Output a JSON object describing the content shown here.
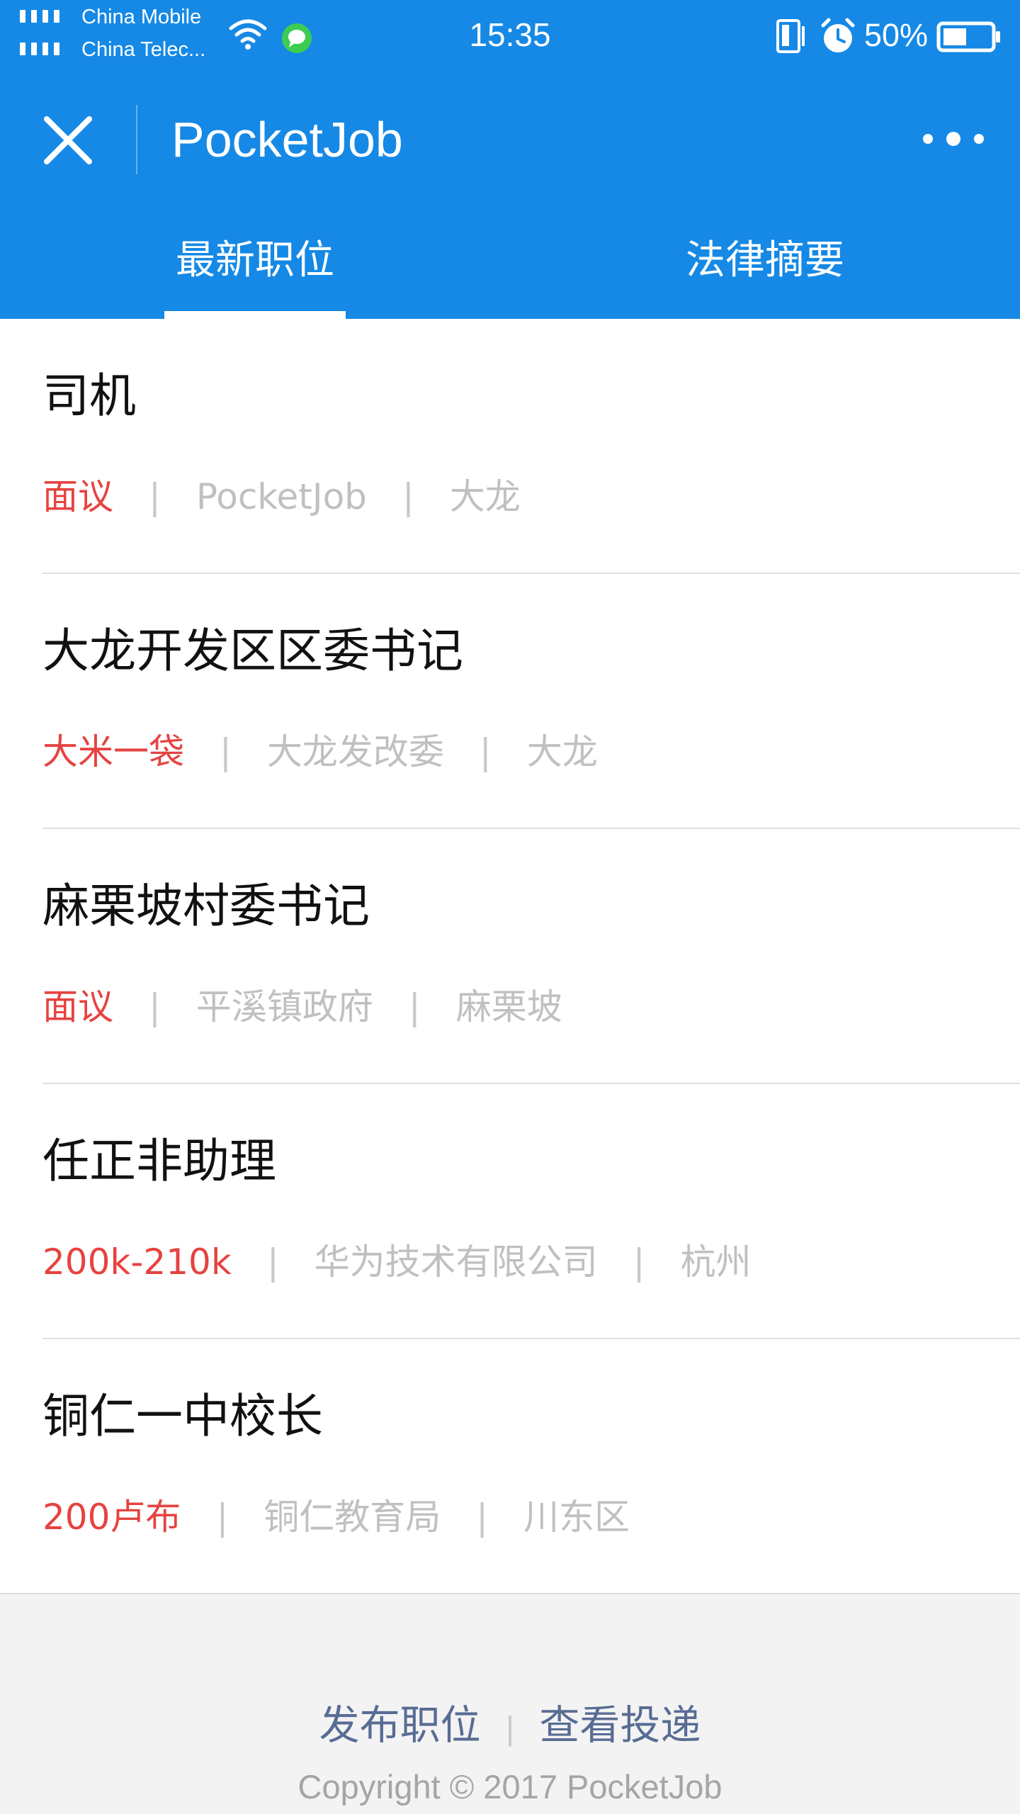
{
  "status_bar": {
    "carrier_1": "China Mobile",
    "carrier_2": "China Telec...",
    "time": "15:35",
    "battery_percent": "50%",
    "battery_level": 0.5
  },
  "header": {
    "title": "PocketJob",
    "close_icon": "close-icon",
    "more_icon": "more-icon",
    "color": "#1589e5"
  },
  "tabs": [
    {
      "label": "最新职位",
      "active": true
    },
    {
      "label": "法律摘要",
      "active": false
    }
  ],
  "jobs": [
    {
      "title": "司机",
      "salary": "面议",
      "company": "PocketJob",
      "location": "大龙"
    },
    {
      "title": "大龙开发区区委书记",
      "salary": "大米一袋",
      "company": "大龙发改委",
      "location": "大龙"
    },
    {
      "title": "麻栗坡村委书记",
      "salary": "面议",
      "company": "平溪镇政府",
      "location": "麻栗坡"
    },
    {
      "title": "任正非助理",
      "salary": "200k-210k",
      "company": "华为技术有限公司",
      "location": "杭州"
    },
    {
      "title": "铜仁一中校长",
      "salary": "200卢布",
      "company": "铜仁教育局",
      "location": "川东区"
    }
  ],
  "meta_separator": "|",
  "footer": {
    "post_job": "发布职位",
    "separator": "|",
    "view_applications": "查看投递",
    "copyright": "Copyright © 2017 PocketJob"
  },
  "colors": {
    "accent": "#1589e5",
    "salary": "#e64340",
    "link": "#586c94"
  }
}
